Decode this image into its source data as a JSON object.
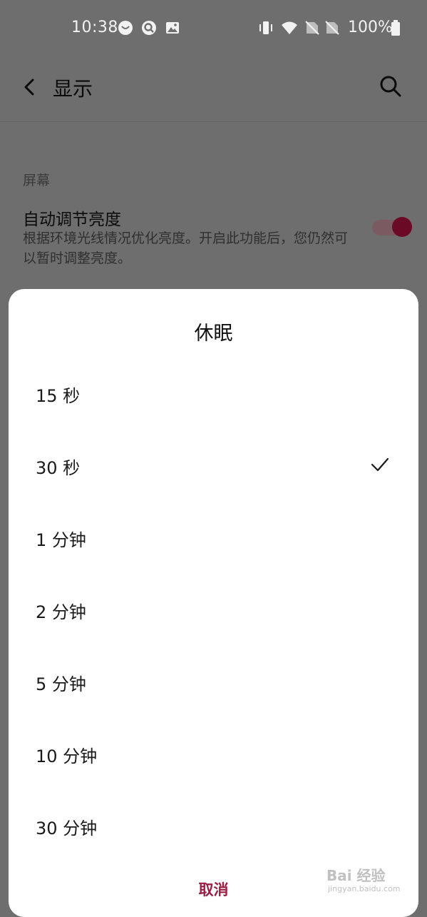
{
  "status_bar": {
    "time": "10:38",
    "battery": "100%",
    "icons": [
      "notification-icon",
      "app-notification-icon",
      "image-notification-icon",
      "vibrate-icon",
      "wifi-icon",
      "no-sim-icon",
      "no-sim-icon",
      "battery-icon"
    ]
  },
  "app_bar": {
    "title": "显示"
  },
  "screen_section": {
    "title": "屏幕",
    "auto_brightness": {
      "title": "自动调节亮度",
      "description": "根据环境光线情况优化亮度。开启此功能后，您仍然可以暂时调整亮度。",
      "enabled": true
    }
  },
  "dialog": {
    "title": "休眠",
    "options": [
      {
        "label": "15 秒",
        "selected": false
      },
      {
        "label": "30 秒",
        "selected": true
      },
      {
        "label": "1 分钟",
        "selected": false
      },
      {
        "label": "2 分钟",
        "selected": false
      },
      {
        "label": "5 分钟",
        "selected": false
      },
      {
        "label": "10 分钟",
        "selected": false
      },
      {
        "label": "30 分钟",
        "selected": false
      }
    ],
    "cancel": "取消"
  },
  "watermark": {
    "line1": "Bai 经验",
    "line2": "jingyan.baidu.com"
  },
  "colors": {
    "accent": "#9b1d43",
    "scrim": "#6e6e6e",
    "dialog_bg": "#ffffff"
  }
}
